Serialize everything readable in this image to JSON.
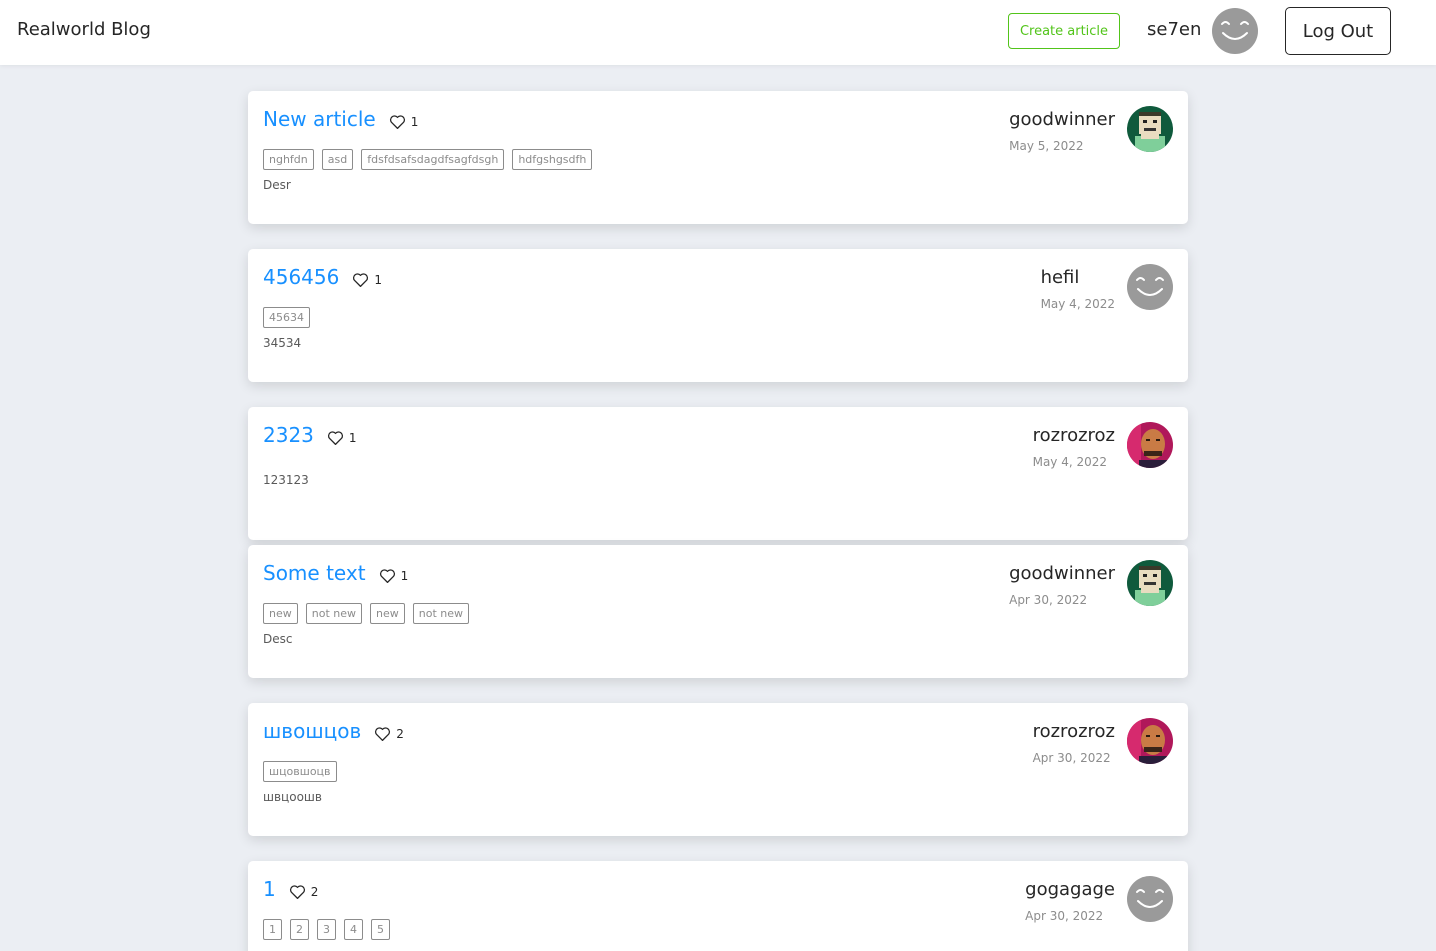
{
  "header": {
    "brand": "Realworld Blog",
    "create_label": "Create article",
    "username": "se7en",
    "logout_label": "Log Out"
  },
  "articles": [
    {
      "title": "New article",
      "likes": "1",
      "tags": [
        "nghfdn",
        "asd",
        "fdsfdsafsdagdfsagfdsgh",
        "hdfgshgsdfh"
      ],
      "description": "Desr",
      "author": "goodwinner",
      "date": "May 5, 2022",
      "avatar": "pixel-avatar"
    },
    {
      "title": "456456",
      "likes": "1",
      "tags": [
        "45634"
      ],
      "description": "34534",
      "author": "hefil",
      "date": "May 4, 2022",
      "avatar": "smiley-avatar"
    },
    {
      "title": "2323",
      "likes": "1",
      "tags": [],
      "description": "123123",
      "author": "rozrozroz",
      "date": "May 4, 2022",
      "avatar": "photo-avatar"
    },
    {
      "title": "Some text",
      "likes": "1",
      "tags": [
        "new",
        "not new",
        "new",
        "not new"
      ],
      "description": "Desc",
      "author": "goodwinner",
      "date": "Apr 30, 2022",
      "avatar": "pixel-avatar"
    },
    {
      "title": "швошцов",
      "likes": "2",
      "tags": [
        "шцовшоцв"
      ],
      "description": "швцоошв",
      "author": "rozrozroz",
      "date": "Apr 30, 2022",
      "avatar": "photo-avatar"
    },
    {
      "title": "1",
      "likes": "2",
      "tags": [
        "1",
        "2",
        "3",
        "4",
        "5"
      ],
      "description": "",
      "author": "gogagage",
      "date": "Apr 30, 2022",
      "avatar": "smiley-avatar"
    }
  ],
  "colors": {
    "accent": "#1890ff",
    "create": "#52c41a",
    "background": "#ebeef3"
  }
}
